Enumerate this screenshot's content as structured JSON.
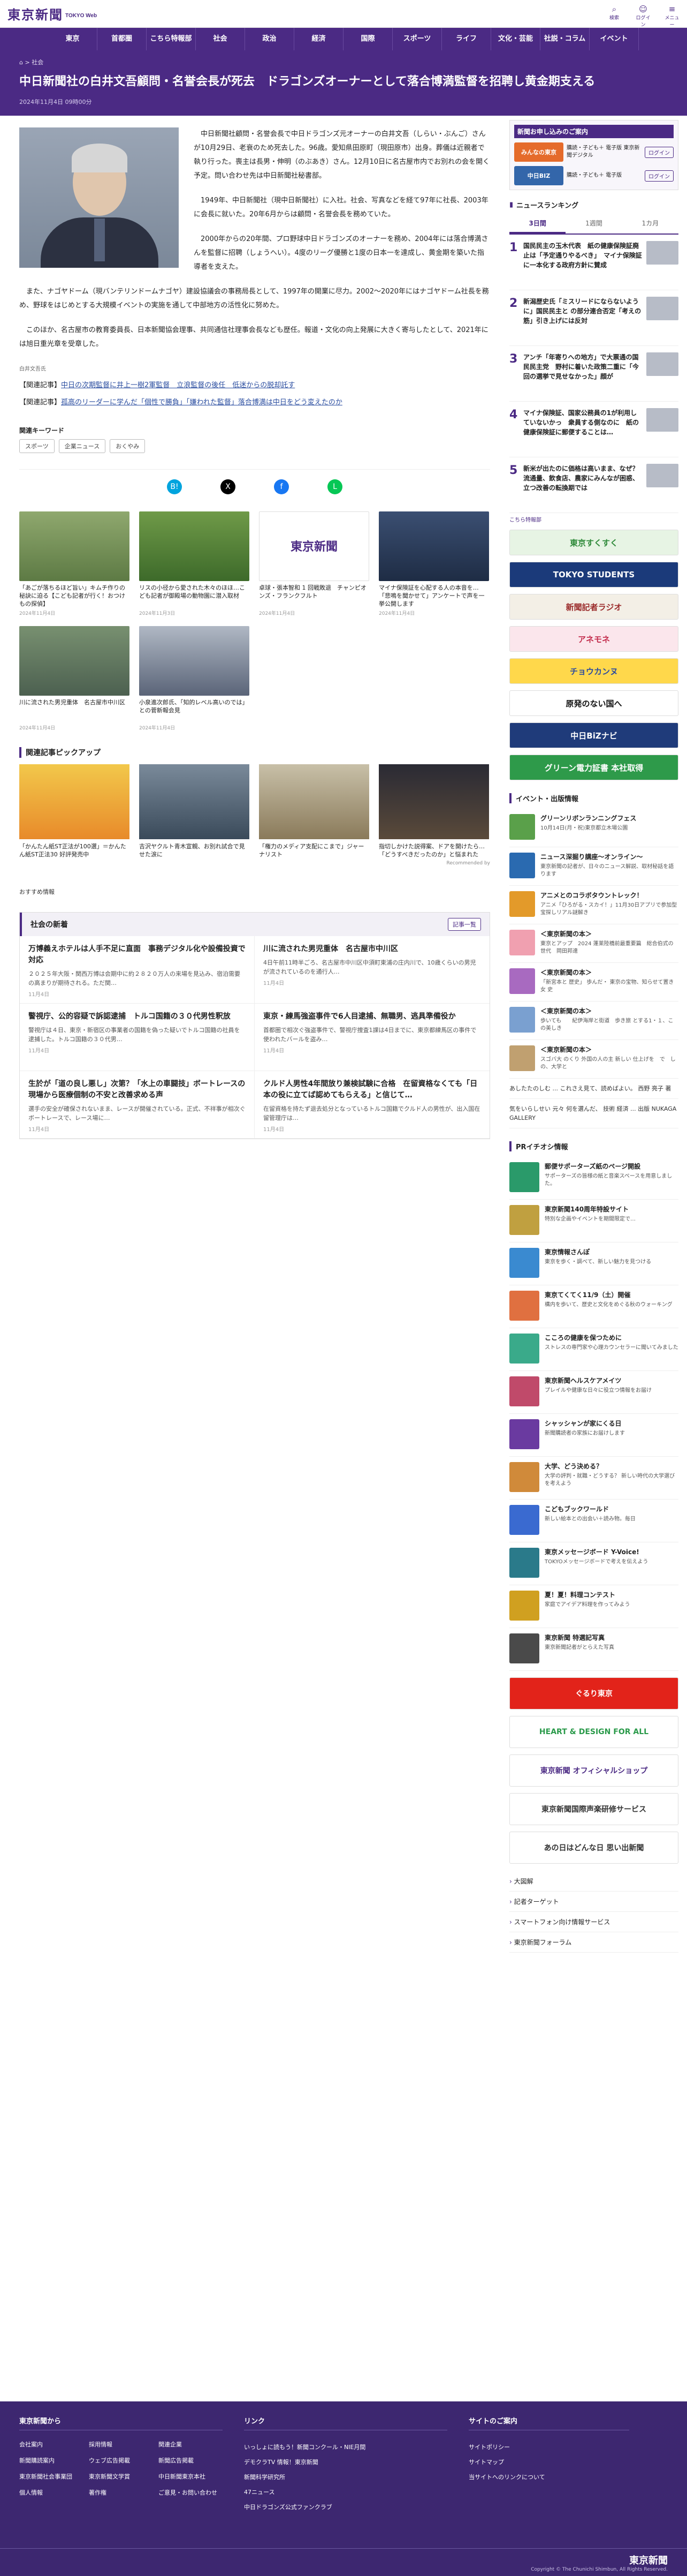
{
  "header": {
    "logo": "東京新聞",
    "logo_sub": "TOKYO Web",
    "icons": [
      {
        "label": "検索",
        "icon": "search-icon"
      },
      {
        "label": "ログイン",
        "icon": "user-icon"
      },
      {
        "label": "メニュー",
        "icon": "menu-icon"
      }
    ]
  },
  "nav": [
    "東京",
    "首都圏",
    "こちら特報部",
    "社会",
    "政治",
    "経済",
    "国際",
    "スポーツ",
    "ライフ",
    "文化・芸能",
    "社説・コラム",
    "イベント"
  ],
  "article": {
    "breadcrumb": [
      "社会"
    ],
    "title": "中日新聞社の白井文吾顧問・名誉会長が死去　ドラゴンズオーナーとして落合博満監督を招聘し黄金期支える",
    "date": "2024年11月4日 09時00分",
    "photo_caption": "白井文吾氏",
    "paragraphs": [
      "中日新聞社顧問・名誉会長で中日ドラゴンズ元オーナーの白井文吾（しらい・ぶんご）さんが10月29日、老衰のため死去した。96歳。愛知県田原町（現田原市）出身。葬儀は近親者で執り行った。喪主は長男・伸明（のぶあき）さん。12月10日に名古屋市内でお別れの会を開く予定。問い合わせ先は中日新聞社秘書部。",
      "1949年、中日新聞社（現中日新聞社）に入社。社会、写真などを経て97年に社長、2003年に会長に就いた。20年6月からは顧問・名誉会長を務めていた。",
      "2000年からの20年間、プロ野球中日ドラゴンズのオーナーを務め、2004年には落合博満さんを監督に招聘（しょうへい）。4度のリーグ優勝と1度の日本一を達成し、黄金期を築いた指導者を支えた。",
      "また、ナゴヤドーム（現バンテリンドームナゴヤ）建設協議会の事務局長として、1997年の開業に尽力。2002〜2020年にはナゴヤドーム社長を務め、野球をはじめとする大規模イベントの実施を通して中部地方の活性化に努めた。",
      "このほか、名古屋市の教育委員長、日本新聞協会理事、共同通信社理事会長なども歴任。報道・文化の向上発展に大きく寄与したとして、2021年には旭日重光章を受章した。"
    ],
    "related": [
      {
        "prefix": "【関連記事】",
        "text": "中日の次期監督に井上一樹2軍監督　立浪監督の後任　低迷からの脱却託す"
      },
      {
        "prefix": "【関連記事】",
        "text": "孤高のリーダーに学んだ「個性で勝負」「嫌われた監督」落合博満は中日をどう変えたのか"
      }
    ],
    "keywords_title": "関連キーワード",
    "keywords": [
      "スポーツ",
      "企業ニュース",
      "おくやみ"
    ]
  },
  "share_icons": [
    "hatena-icon",
    "x-icon",
    "facebook-icon",
    "line-icon"
  ],
  "related_cards": [
    {
      "title": "「あごが落ちるほど旨い」キムチ作りの秘訣に迫る【こども記者が行く！おつけもの探偵】",
      "date": "2024年11月4日"
    },
    {
      "title": "リスの小径から愛された木々のほほ…こども記者が御殿場の動物園に潜入取材",
      "date": "2024年11月3日"
    },
    {
      "title": "卓球・張本智和 1 回戦敗退　チャンピオンズ・フランクフルト",
      "date": "2024年11月4日"
    },
    {
      "title": "マイナ保険証を心配する人の本音を…「悲鳴を聞かせて」アンケートで声を一挙公開します",
      "date": "2024年11月4日"
    },
    {
      "title": "川に流された男児重体　名古屋市中川区",
      "date": "2024年11月4日"
    },
    {
      "title": "小泉進次郎氏、「知的レベル高いのでは」との菅新報会見",
      "date": "2024年11月4日"
    }
  ],
  "pickup": {
    "title": "関連記事ピックアップ",
    "items": [
      "「かんたん紙ST正法が100選」＝かんたん紙ST正法30 好評発売中",
      "吉沢ヤクルト青木宣親、お別れ試合で見せた涙に",
      "「権力のメディア支配にこまで」ジャーナリスト",
      "指切しかけた説得案、ドアを開けたら…「どうすべきだったのか」と悩まれた"
    ],
    "rec_by": "Recommended by"
  },
  "recommend_label": "おすすめ情報",
  "society": {
    "title": "社会の新着",
    "more": "記事一覧",
    "items": [
      {
        "title": "万博義えホテルは人手不足に直面　事務デジタル化や設備投資で対応",
        "text": "２０２５年大阪・関西万博は会期中に約２８２０万人の来場を見込み、宿泊需要の高まりが期待される。ただ関…",
        "date": "11月4日"
      },
      {
        "title": "川に流された男児重体　名古屋市中川区",
        "text": "4日午前11時半ごろ、名古屋市中川区中須町東浦の庄内川で、10歳くらいの男児が流されているのを通行人…",
        "date": "11月4日"
      },
      {
        "title": "警視庁、公的容疑で訴認逮捕　トルコ国籍の３０代男性釈放",
        "text": "警視庁は４日、東京・新宿区の事業者の国籍を偽った疑いでトルコ国籍の社員を逮捕した。トルコ国籍の３０代男…",
        "date": "11月4日"
      },
      {
        "title": "東京・練馬強盗事件で6人目逮捕、無職男、逃具準備役か",
        "text": "首都圏で相次ぐ強盗事件で、警視庁捜査1課は4日までに、東京都練馬区の事件で使われたバールを盗み…",
        "date": "11月4日"
      },
      {
        "title": "生於が「道の良し悪し」次第？「水上の車闘技」ボートレースの現場から医療個制の不安と改善求める声",
        "text": "選手の安全が確保されないまま、レースが開催されている。正式、不祥事が相次ぐボートレースで、レース場に…",
        "date": "11月4日"
      },
      {
        "title": "クルド人男性4年間放り兼検試験に合格　在留資格なくても「日本の役に立てば認めてもらえる」と信じて…",
        "text": "在留資格を持たず退去処分となっているトルコ国籍でクルド人の男性が、出入国在留管理庁は…",
        "date": "11月4日"
      }
    ]
  },
  "side": {
    "sub_box": {
      "title": "新聞お申し込みのご案内",
      "rows": [
        {
          "logo": "みんなの東京",
          "text": "購読・子ども＋ 電子版 東京新聞デジタル",
          "btn": "ログイン"
        },
        {
          "logo": "中日BIZ",
          "text": "購読・子ども＋ 電子版",
          "btn": "ログイン"
        }
      ]
    },
    "ranking": {
      "title": "ニュースランキング",
      "tabs": [
        "3日間",
        "1週間",
        "1カ月"
      ],
      "items": [
        "国民民主の玉木代表　紙の健康保険証廃止は「予定通りやるべき」　マイナ保険証に一本化する政府方針に賛成",
        "新潟歴史氏「ミスリードにならないように」国民民主と の部分連合否定「考えの筋」引き上げには反対",
        "アンチ「年寄りへの地方」で大票通の国民民主党　野村に着いた政策二重に「今回の選挙で見せなかった」顔が",
        "マイナ保険証、国家公務員の1が利用していないかっ　衆員する側なのに　紙の健康保険証に郵便することは…",
        "新米が出たのに価格は高いまま、なぜ？　流通量、飲食店、農家にみんなが困惑、立つ改善の転換期では"
      ],
      "more": "こちら特報部"
    },
    "banners": [
      "東京すくすく",
      "TOKYO STUDENTS",
      "新聞記者ラジオ",
      "アネモネ",
      "チョウカンヌ",
      "原発のない国へ",
      "中日BiZナビ",
      "グリーン電力証書 本社取得"
    ],
    "events_title": "イベント・出版情報",
    "events": [
      {
        "t": "グリーンリボンランニングフェス",
        "x": "10月14日(月・祝)東京都立木場公園"
      },
      {
        "t": "ニュース深掘り講座〜オンライン〜",
        "x": "東京新聞の記者が、日々のニュース解説、取材秘話を語ります"
      },
      {
        "t": "アニメとのコラボタウントレック！",
        "x": "アニメ「ひろがる・スカイ！」11月30日アプリで参加型宝探しリアル謎解き"
      },
      {
        "t": "＜東京新聞の本＞",
        "x": "東京とアップ　2024 蓬莱陸橋前最重要篇　総合伯式の世代　岡田邦達"
      },
      {
        "t": "＜東京新聞の本＞",
        "x": "「新宮本と 歴史」 歩んだ・ 東京の宝物、知らせて置き 女 史"
      },
      {
        "t": "＜東京新聞の本＞",
        "x": "歩いても　　紀伊海岸と街道　歩き旅 とする1・１、この美しき"
      },
      {
        "t": "＜東京新聞の本＞",
        "x": "スゴバ大 のくり 外国の人の主 新しい 仕上げを　で　しの、大学と"
      }
    ],
    "plain_links": [
      "あしたたのしむ ... これさえ見て、読めばよい。 西野 亮子 著",
      "気をいらしせい 元々 何を選んだ、 技術 経済 ... 出版 NUKAGA GALLERY"
    ],
    "pr_title": "PRイチオシ情報",
    "pr": [
      {
        "t": "郵便サポーターズ紙のページ開設",
        "x": "サポーターズの皆様の紙と音楽スペースを用意しました。"
      },
      {
        "t": "東京新聞140周年特設サイト",
        "x": "特別な企画やイベントを期間限定で…"
      },
      {
        "t": "東京情報さんぽ",
        "x": "東京を歩く・調べて、新しい魅力を見つける"
      },
      {
        "t": "東京てくてく11/9（土）開催",
        "x": "構内を歩いて、歴史と文化をめぐる秋のウォーキング"
      },
      {
        "t": "こころの健康を保つために",
        "x": "ストレスの専門家や心理カウンセラーに聞いてみました"
      },
      {
        "t": "東京新聞ヘルスケアメイツ",
        "x": "プレイルや健康な日々に役立つ情報をお届け"
      },
      {
        "t": "シャッシャンが家にくる日",
        "x": "新聞購読者の家族にお届けします"
      },
      {
        "t": "大学、どう決める？",
        "x": "大学の評判・就職・どうする？ 新しい時代の大学選びを考えよう"
      },
      {
        "t": "こどもブックワールド",
        "x": "新しい絵本との出会い＋読み物。毎日"
      },
      {
        "t": "東京メッセージボード Y-Voice!",
        "x": "TOKYOメッセージボードで考えを伝えよう"
      },
      {
        "t": "夏！夏！料理コンテスト",
        "x": "家庭でアイデア料理を作ってみよう"
      },
      {
        "t": "東京新聞 特選記写真",
        "x": "東京新聞記者がとらえた写真"
      }
    ],
    "banners2": [
      "ぐるり東京",
      "HEART & DESIGN FOR ALL",
      "東京新聞 オフィシャルショップ",
      "東京新聞国際声楽研修サービス",
      "あの日はどんな日 思い出新聞"
    ],
    "links": [
      "大図解",
      "記者ターゲット",
      "スマートフォン向け情報サービス",
      "東京新聞フォーラム"
    ]
  },
  "footer": {
    "col1": {
      "title": "東京新聞から",
      "items": [
        "会社案内",
        "採用情報",
        "関連企業",
        "新聞購読案内",
        "ウェブ広告掲載",
        "新聞広告掲載",
        "東京新聞社会事業団",
        "東京新聞文学賞",
        "中日新聞東京本社",
        "個人情報",
        "著作権",
        "ご意見・お問い合わせ"
      ]
    },
    "col2": {
      "title": "リンク",
      "items": [
        "いっしょに読もう！新聞コンクール・NIE月間",
        "デモクラTV 情報！東京新聞",
        "新聞科学研究所",
        "47ニュース",
        "中日ドラゴンズ公式ファンクラブ"
      ]
    },
    "col3": {
      "title": "サイトのご案内",
      "items": [
        "サイトポリシー",
        "サイトマップ",
        "当サイトへのリンクについて"
      ]
    },
    "logo": "東京新聞",
    "copyright": "Copyright © The Chunichi Shimbun, All Rights Reserved."
  },
  "colors": {
    "brand": "#4b2a84",
    "footer": "#3d2770"
  }
}
